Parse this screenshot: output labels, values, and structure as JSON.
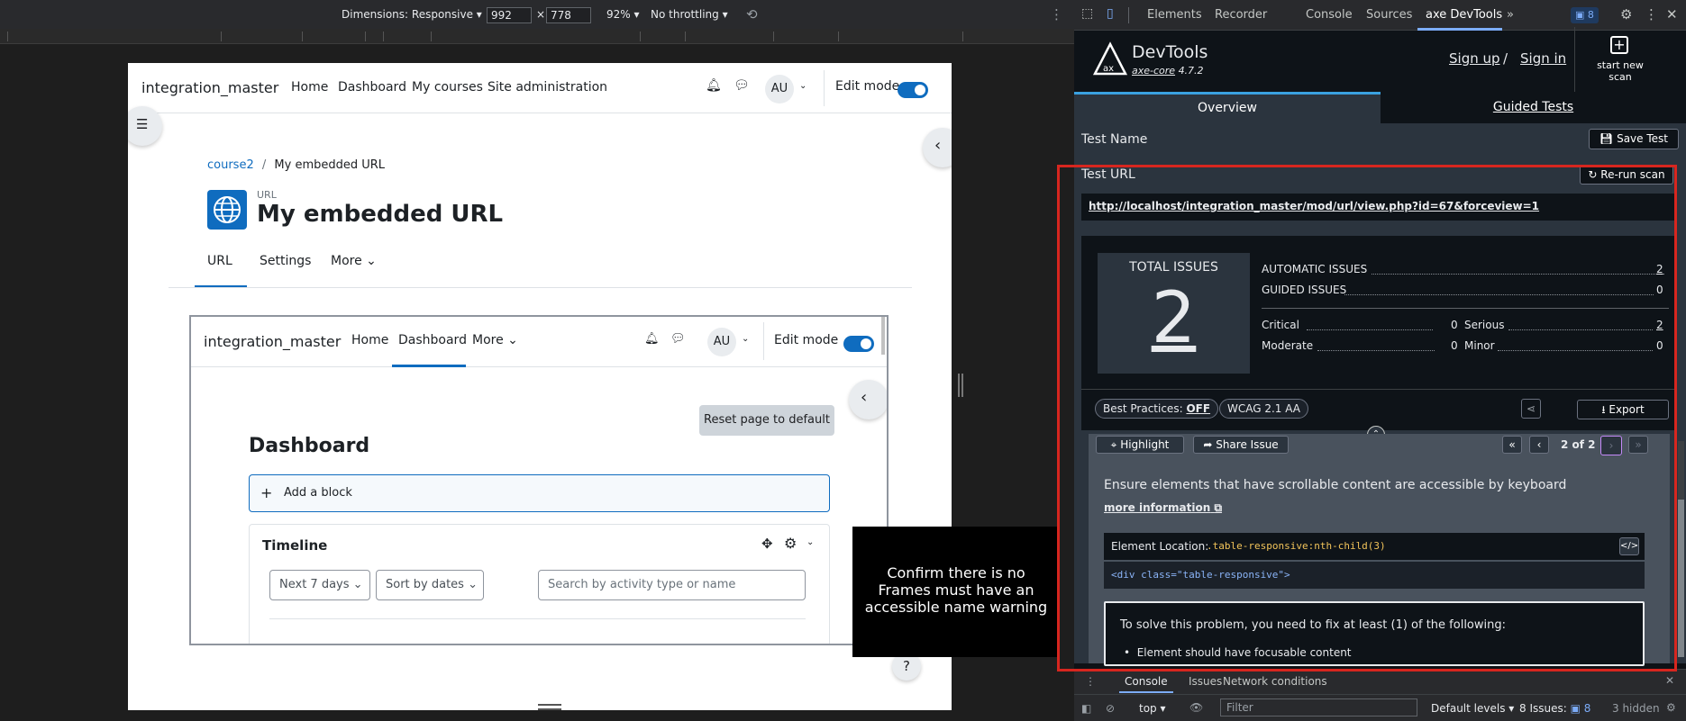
{
  "device_toolbar": {
    "dimensions_label": "Dimensions: Responsive",
    "width_value": "992",
    "times": "×",
    "height_value": "778",
    "zoom": "92%",
    "throttling": "No throttling"
  },
  "page": {
    "site_name": "integration_master",
    "nav": [
      "Home",
      "Dashboard",
      "My courses",
      "Site administration"
    ],
    "avatar": "AU",
    "edit_mode": "Edit mode",
    "breadcrumb_course": "course2",
    "breadcrumb_sep": "/",
    "breadcrumb_current": "My embedded URL",
    "activity_type": "URL",
    "activity_title": "My embedded URL",
    "tabs": [
      "URL",
      "Settings",
      "More"
    ],
    "embedded": {
      "site_name": "integration_master",
      "nav": [
        "Home",
        "Dashboard",
        "More"
      ],
      "avatar": "AU",
      "edit_mode": "Edit mode",
      "reset_button": "Reset page to default",
      "heading": "Dashboard",
      "add_block": "Add a block",
      "timeline_title": "Timeline",
      "filter_days": "Next 7 days",
      "sort": "Sort by dates",
      "search_placeholder": "Search by activity type or name"
    },
    "help": "?",
    "tooltip": "Confirm there is no Frames must have an accessible name warning"
  },
  "devtools": {
    "tabs": [
      "Elements",
      "Recorder",
      "Console",
      "Sources",
      "axe DevTools"
    ],
    "issues_badge": "8",
    "title": "DevTools",
    "axe_core": "axe-core",
    "version": "4.7.2",
    "sign_up": "Sign up",
    "slash": "/",
    "sign_in": "Sign in",
    "start_scan": "start new scan",
    "overview_tab": "Overview",
    "guided_tab": "Guided Tests",
    "test_name_label": "Test Name",
    "save_test": "Save Test",
    "test_url_label": "Test URL",
    "rerun": "Re-run scan",
    "test_url": "http://localhost/integration_master/mod/url/view.php?id=67&forceview=1",
    "total_issues_label": "TOTAL ISSUES",
    "total_issues": "2",
    "automatic_label": "AUTOMATIC ISSUES",
    "automatic": "2",
    "guided_label": "GUIDED ISSUES",
    "guided": "0",
    "critical_label": "Critical",
    "critical": "0",
    "serious_label": "Serious",
    "serious": "2",
    "moderate_label": "Moderate",
    "moderate": "0",
    "minor_label": "Minor",
    "minor": "0",
    "best_practices": "Best Practices:",
    "best_practices_state": "OFF",
    "wcag": "WCAG 2.1 AA",
    "export": "Export",
    "highlight": "Highlight",
    "share_issue": "Share Issue",
    "pager": "2 of 2",
    "issue_title": "Ensure elements that have scrollable content are accessible by keyboard",
    "more_info": "more information",
    "element_location_label": "Element Location:",
    "element_selector": ".table-responsive:nth-child(3)",
    "element_html": "<div class=\"table-responsive\">",
    "solve_intro": "To solve this problem, you need to fix at least (1) of the following:",
    "solve_item": "Element should have focusable content",
    "console_tabs": [
      "Console",
      "Issues",
      "Network conditions"
    ],
    "context": "top",
    "filter_placeholder": "Filter",
    "levels": "Default levels",
    "issues_count": "8 Issues:",
    "issues_count_badge": "8",
    "hidden": "3 hidden"
  },
  "colors": {
    "accent": "#0f6cbf",
    "axe_accent": "#3aa1e0",
    "highlight_border": "#d7261f"
  }
}
